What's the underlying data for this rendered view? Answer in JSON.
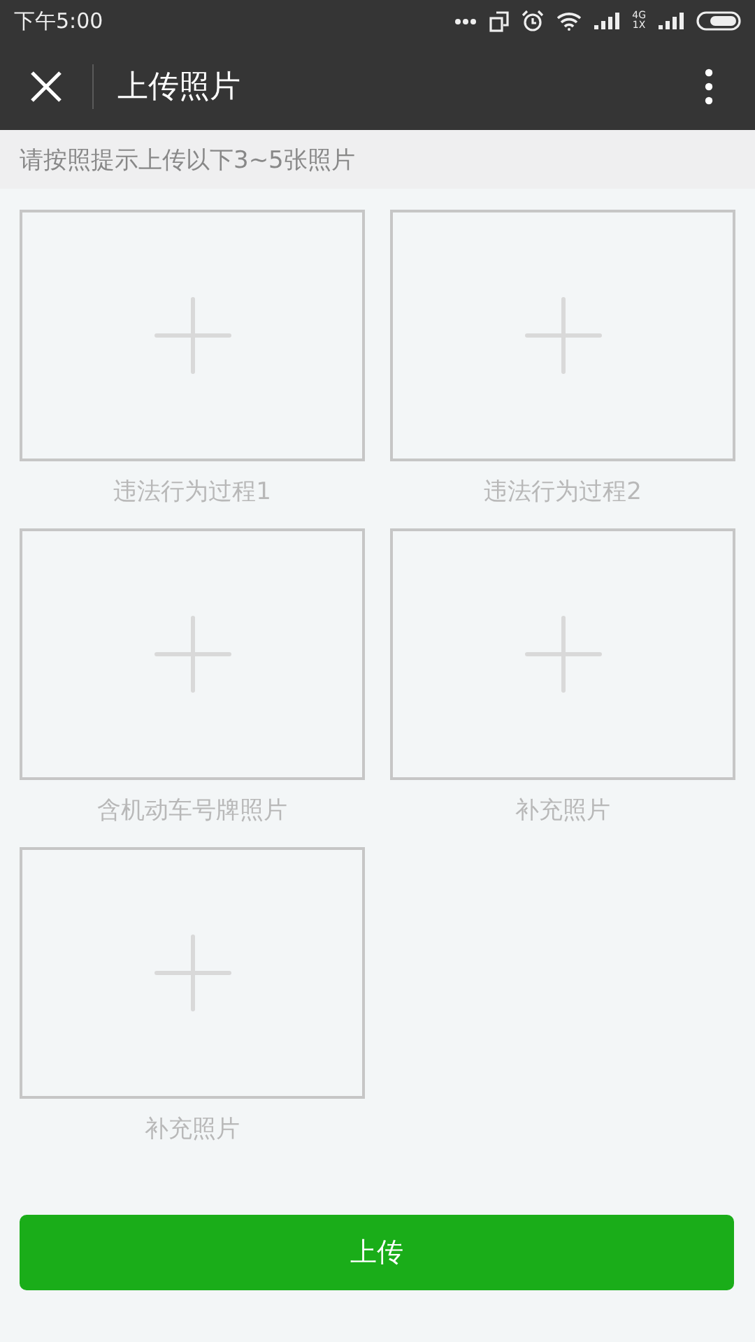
{
  "status_bar": {
    "time": "下午5:00",
    "network_badge": "4G\n1X"
  },
  "nav": {
    "title": "上传照片"
  },
  "hint": "请按照提示上传以下3~5张照片",
  "slots": [
    {
      "label": "违法行为过程1"
    },
    {
      "label": "违法行为过程2"
    },
    {
      "label": "含机动车号牌照片"
    },
    {
      "label": "补充照片"
    },
    {
      "label": "补充照片"
    }
  ],
  "buttons": [
    {
      "label": "上传"
    }
  ]
}
